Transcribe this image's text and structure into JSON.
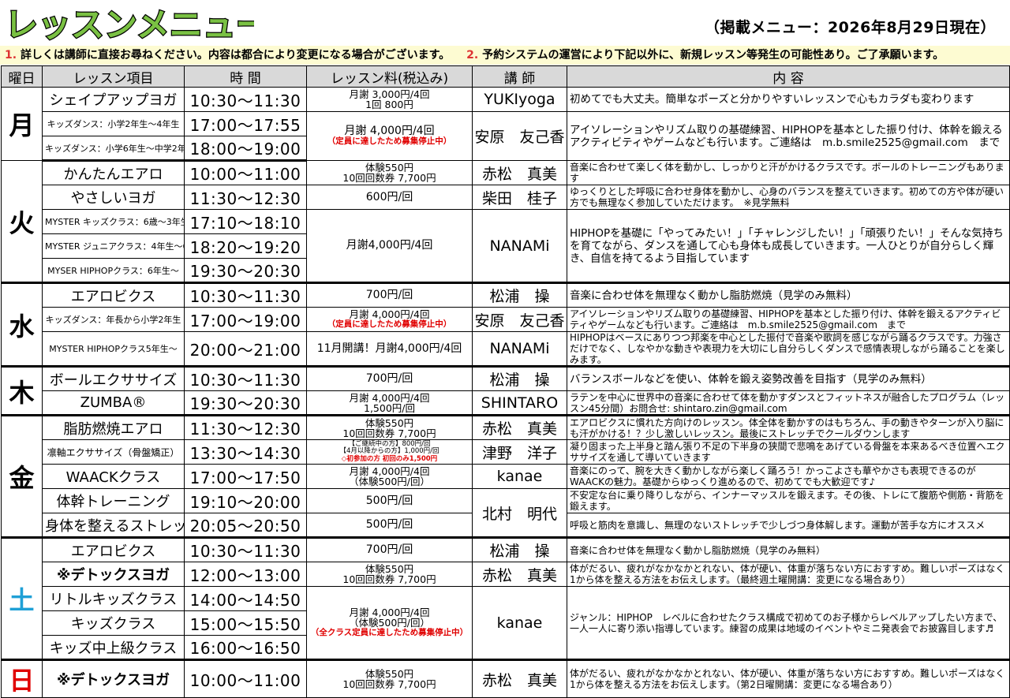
{
  "header": {
    "title": "レッスンメニュー",
    "as_of": "（掲載メニュー：2026年8月29日現在）",
    "title_fill": "#7ac143",
    "day_sat_color": "#1fa0d6",
    "day_sun_color": "#e00000"
  },
  "notices": [
    {
      "num": "1.",
      "text": "詳しくは講師に直接お尋ねください。内容は都合により変更になる場合がございます。"
    },
    {
      "num": "2.",
      "text": "予約システムの運営により下記以外に、新規レッスン等発生の可能性あり。ご了承願います。"
    }
  ],
  "columns": [
    "曜日",
    "レッスン項目",
    "時 間",
    "レッスン料(税込み)",
    "講 師",
    "内 容"
  ],
  "days": {
    "mon": "月",
    "tue": "火",
    "wed": "水",
    "thu": "木",
    "fri": "金",
    "sat": "土",
    "sun": "日"
  },
  "rows": {
    "mon1": {
      "lesson": "シェイプアップヨガ",
      "time": "10:30～11:30",
      "fee": [
        "月謝 3,000円/4回",
        "1回  800円"
      ],
      "teacher": "YUKIyoga",
      "content": "初めてでも大丈夫。簡単なポーズと分かりやすいレッスンで心もカラダも変わります"
    },
    "mon2": {
      "lesson": "キッズダンス：小学2年生～4年生",
      "time": "17:00～17:55"
    },
    "mon3": {
      "lesson": "キッズダンス：小学6年生～中学2年生",
      "time": "18:00～19:00"
    },
    "mon23": {
      "fee": [
        "月謝 4,000円/4回"
      ],
      "fee_note": "（定員に達したため募集停止中）",
      "teacher": "安原　友己香",
      "content": "アイソレーションやリズム取りの基礎練習、HIPHOPを基本とした振り付け、体幹を鍛えるアクティビティやゲームなども行います。ご連絡は　m.b.smile2525@gmail.com　まで"
    },
    "tue1": {
      "lesson": "かんたんエアロ",
      "time": "10:00～11:00",
      "fee": [
        "体験550円",
        "10回回数券 7,700円"
      ],
      "teacher": "赤松　真美",
      "content": "音楽に合わせて楽しく体を動かし、しっかりと汗がかけるクラスです。ボールのトレーニングもあります"
    },
    "tue2": {
      "lesson": "やさしいヨガ",
      "time": "11:30～12:30",
      "fee": [
        "600円/回"
      ],
      "teacher": "柴田　桂子",
      "content": "ゆっくりとした呼吸に合わせ身体を動かし、心身のバランスを整えていきます。初めての方や体が硬い方でも無理なく参加していただけます。　※見学無料"
    },
    "tue3": {
      "lesson": "MYSTER キッズクラス：6歳～3年生",
      "time": "17:10～18:10"
    },
    "tue4": {
      "lesson": "MYSTER ジュニアクラス：4年生～6年生",
      "time": "18:20～19:20"
    },
    "tue5": {
      "lesson": "MYSER HIPHOPクラス：6年生～",
      "time": "19:30～20:30"
    },
    "tue345": {
      "fee": [
        "月謝4,000円/4回"
      ],
      "teacher": "NANAMi",
      "content": "HIPHOPを基礎に「やってみたい！」「チャレンジしたい！」「頑張りたい！」そんな気持ちを育てながら、ダンスを通して心も身体も成長していきます。一人ひとりが自分らしく輝き、自信を持てるよう目指しています"
    },
    "wed1": {
      "lesson": "エアロビクス",
      "time": "10:30～11:30",
      "fee": [
        "700円/回"
      ],
      "teacher": "松浦　操",
      "content": "音楽に合わせ体を無理なく動かし脂肪燃焼（見学のみ無料）"
    },
    "wed2": {
      "lesson": "キッズダンス：年長から小学2年生",
      "time": "17:00～19:00",
      "fee": [
        "月謝 4,000円/4回"
      ],
      "fee_note": "（定員に達したため募集停止中）",
      "teacher": "安原　友己香",
      "content": "アイソレーションやリズム取りの基礎練習、HIPHOPを基本とした振り付け、体幹を鍛えるアクティビティやゲームなども行います。ご連絡は　m.b.smile2525@gmail.com　まで"
    },
    "wed3": {
      "lesson": "MYSTER HIPHOPクラス5年生～",
      "time": "20:00～21:00",
      "fee": [
        "11月開講！月謝4,000円/4回"
      ],
      "teacher": "NANAMi",
      "content": "HIPHOPはベースにありつつ邦楽を中心とした振付で音楽や歌詞を感じながら踊るクラスです。力強さだけでなく、しなやかな動きや表現力を大切にし自分らしくダンスで感情表現しながら踊ることを楽しみます。"
    },
    "thu1": {
      "lesson": "ボールエクササイズ",
      "time": "10:30～11:30",
      "fee": [
        "700円/回"
      ],
      "teacher": "松浦　操",
      "content": "バランスボールなどを使い、体幹を鍛え姿勢改善を目指す（見学のみ無料）"
    },
    "thu2": {
      "lesson": "ZUMBA®",
      "time": "19:30～20:30",
      "fee": [
        "月謝 4,000円/4回",
        "1,500円/回"
      ],
      "teacher": "SHINTARO",
      "content": "ラテンを中心に世界中の音楽に合わせて体を動かすダンスとフィットネスが融合したプログラム（レッスン45分間）お問合せ: shintaro.zin@gmail.com"
    },
    "fri1": {
      "lesson": "脂肪燃焼エアロ",
      "time": "11:30～12:30",
      "fee": [
        "体験550円",
        "10回回数券 7,700円"
      ],
      "teacher": "赤松　真美",
      "content": "エアロビクスに慣れた方向けのレッスン。体全体を動かすのはもちろん、手の動きやターンが入り脳にも汗がかける！？少し激しいレッスン。最後にストレッチでクールダウンします"
    },
    "fri2": {
      "lesson": "凛軸エクササイズ（骨盤矯正）",
      "time": "13:30～14:30",
      "fee": [
        "【ご継続中の方】800円/回",
        "【4月以降からの方】1,000円/回"
      ],
      "fee_note": "◇初参加の方 初回のみ1,500円",
      "teacher": "津野　洋子",
      "content": "凝り固まった上半身と踏ん張り不足の下半身の狭間で悲鳴をあげている骨盤を本来あるべき位置へエクササイズを通して導いていきます"
    },
    "fri3": {
      "lesson": "WAACKクラス",
      "time": "17:00～17:50",
      "fee": [
        "月謝 4,000円/4回",
        "（体験500円/回）"
      ],
      "teacher": "kanae",
      "content": "音楽にのって、腕を大きく動かしながら楽しく踊ろう！かっこよさも華やかさも表現できるのがWAACKの魅力。基礎からゆっくり進めるので、初めてでも大歓迎です♪"
    },
    "fri4": {
      "lesson": "体幹トレーニング",
      "time": "19:10～20:00",
      "fee": [
        "500円/回"
      ],
      "content": "不安定な台に乗り降りしながら、インナーマッスルを鍛えます。その後、トレにて腹筋や側筋・背筋を鍛えます。"
    },
    "fri5": {
      "lesson": "身体を整えるストレッチ",
      "time": "20:05～20:50",
      "fee": [
        "500円/回"
      ],
      "content": "呼吸と筋肉を意識し、無理のないストレッチで少しづつ身体解します。運動が苦手な方にオススメ"
    },
    "fri45": {
      "teacher": "北村　明代"
    },
    "sat1": {
      "lesson": "エアロビクス",
      "time": "10:30～11:30",
      "fee": [
        "700円/回"
      ],
      "teacher": "松浦　操",
      "content": "音楽に合わせ体を無理なく動かし脂肪燃焼（見学のみ無料）"
    },
    "sat2": {
      "lesson": "※デトックスヨガ",
      "time": "12:00～13:00",
      "fee": [
        "体験550円",
        "10回回数券 7,700円"
      ],
      "teacher": "赤松　真美",
      "content": "体がだるい、疲れがなかなかとれない、体が硬い、体重が落ちない方におすすめ。難しいポーズはなく1から体を整える方法をお伝えします。（最終週土曜開講：変更になる場合あり）"
    },
    "sat3": {
      "lesson": "リトルキッズクラス",
      "time": "14:00～14:50"
    },
    "sat4": {
      "lesson": "キッズクラス",
      "time": "15:00～15:50"
    },
    "sat5": {
      "lesson": "キッズ中上級クラス",
      "time": "16:00～16:50"
    },
    "sat345": {
      "fee": [
        "月謝 4,000円/4回",
        "（体験500円/回）"
      ],
      "fee_note": "（全クラス定員に達したため募集停止中）",
      "teacher": "kanae",
      "content": "ジャンル：HIPHOP　レベルに合わせたクラス構成で初めてのお子様からレベルアップしたい方まで、一人一人に寄り添い指導しています。練習の成果は地域のイベントやミニ発表会でお披露目します♬"
    },
    "sun1": {
      "lesson": "※デトックスヨガ",
      "time": "10:00～11:00",
      "fee": [
        "体験550円",
        "10回回数券 7,700円"
      ],
      "teacher": "赤松　真美",
      "content": "体がだるい、疲れがなかなかとれない、体が硬い、体重が落ちない方におすすめ。難しいポーズはなく1から体を整える方法をお伝えします。（第2日曜開講：変更になる場合あり）"
    }
  }
}
